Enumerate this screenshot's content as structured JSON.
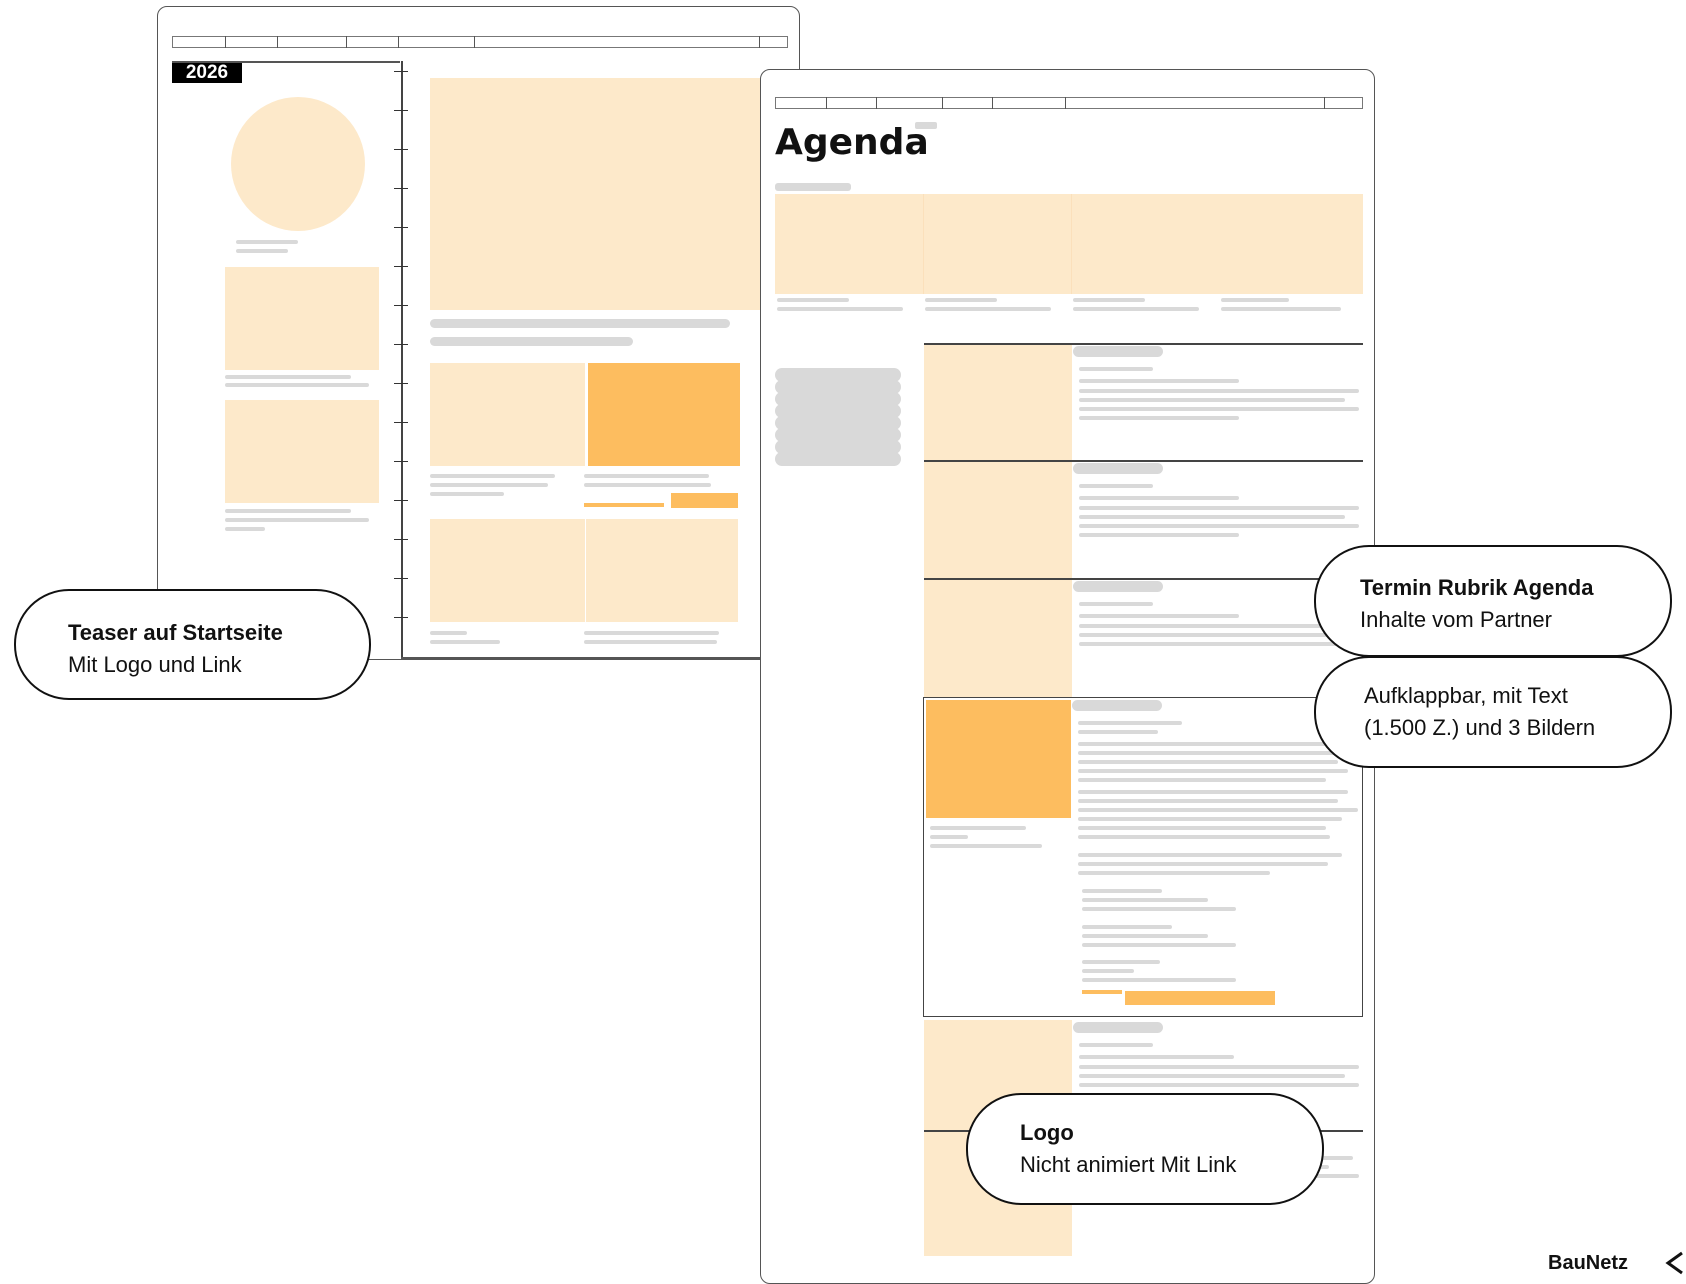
{
  "left_mockup": {
    "year_badge": "2026"
  },
  "right_mockup": {
    "page_title": "Agenda"
  },
  "callouts": {
    "teaser": {
      "title": "Teaser auf Startseite",
      "text": "Mit Logo und Link"
    },
    "termin": {
      "title": "Termin Rubrik Agenda",
      "text": "Inhalte vom Partner"
    },
    "aufklappbar": {
      "line1": "Aufklappbar, mit Text",
      "line2": "(1.500 Z.) und 3 Bildern"
    },
    "logo": {
      "title": "Logo",
      "text": "Nicht animiert Mit Link"
    }
  },
  "brand": {
    "label": "BauNetz"
  },
  "colors": {
    "placeholder_light": "#fde9ca",
    "placeholder_highlight": "#fdbd5f",
    "text_placeholder": "#d9d9d9"
  }
}
